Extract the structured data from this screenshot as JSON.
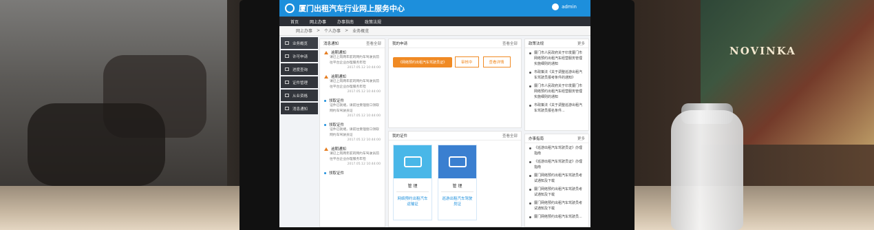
{
  "header": {
    "title": "厦门出租汽车行业网上服务中心",
    "user": "admin"
  },
  "nav": [
    "首页",
    "网上办事",
    "办事指南",
    "政策法规"
  ],
  "breadcrumb": [
    "网上办事",
    ">",
    "个人办事",
    ">",
    "业务概览"
  ],
  "sidebar": [
    "业务概览",
    "许可申请",
    "进度查询",
    "证件管理",
    "从业资格",
    "消息通知"
  ],
  "notices": {
    "title": "消息通知",
    "more": "查看全部",
    "items": [
      {
        "title": "逾期通知",
        "color": "#e67e22",
        "body": "请已上岗两年前的网约车驾驶员前往平台企业办理服务年检",
        "time": "2017.05.12  10:44:00"
      },
      {
        "title": "逾期通知",
        "color": "#e67e22",
        "body": "请已上岗两年前的网约车驾驶员前往平台企业办理服务年检",
        "time": "2017.05.12  10:44:00"
      },
      {
        "title": "领取证件",
        "color": "#1d8fdc",
        "body": "证件已就绪，请前往受理窗口领取网约车驾驶员证",
        "time": "2017.05.12  10:44:00"
      },
      {
        "title": "领取证件",
        "color": "#1d8fdc",
        "body": "证件已就绪，请前往受理窗口领取网约车驾驶员证",
        "time": "2017.05.12  10:44:00"
      },
      {
        "title": "逾期通知",
        "color": "#e67e22",
        "body": "请已上岗两年前的网约车驾驶员前往平台企业办理服务年检",
        "time": "2017.05.12  10:44:00"
      },
      {
        "title": "领取证件",
        "color": "#1d8fdc",
        "body": "",
        "time": ""
      }
    ]
  },
  "apply": {
    "title": "我的申请",
    "more": "查看全部",
    "tag": "《网络预约出租汽车驾驶员证》",
    "status": "审核中",
    "detail": "查看详情"
  },
  "certs": {
    "title": "我的证件",
    "more": "查看全部",
    "items": [
      {
        "manage": "管 理",
        "name": "网络预约出租汽车运输证"
      },
      {
        "manage": "管 理",
        "name": "巡游出租汽车驾驶员证"
      }
    ]
  },
  "policy": {
    "title": "政策法规",
    "more": "更多",
    "items": [
      "厦门市人民政府关于印发厦门市网络预约出租汽车经营服务管理实施细则的通知",
      "市政策法《关于调整巡游出租汽车驾驶员报考条件的通知》",
      "厦门市人民政府关于印发厦门市网络预约出租汽车经营服务管理实施细则的通知",
      "市政策法《关于调整巡游出租汽车驾驶员报名条件..."
    ]
  },
  "guide": {
    "title": "办事指南",
    "more": "更多",
    "items": [
      "《巡游出租汽车驾驶员证》办理指南",
      "《巡游出租汽车驾驶员证》办理指南",
      "厦门网络预约出租汽车驾驶员考试通知及下载",
      "厦门网络预约出租汽车驾驶员考试通知及下载",
      "厦门网络预约出租汽车驾驶员考试通知及下载",
      "厦门网络预约出租汽车驾驶员..."
    ]
  },
  "scene": {
    "sign": "NOVINKA"
  }
}
